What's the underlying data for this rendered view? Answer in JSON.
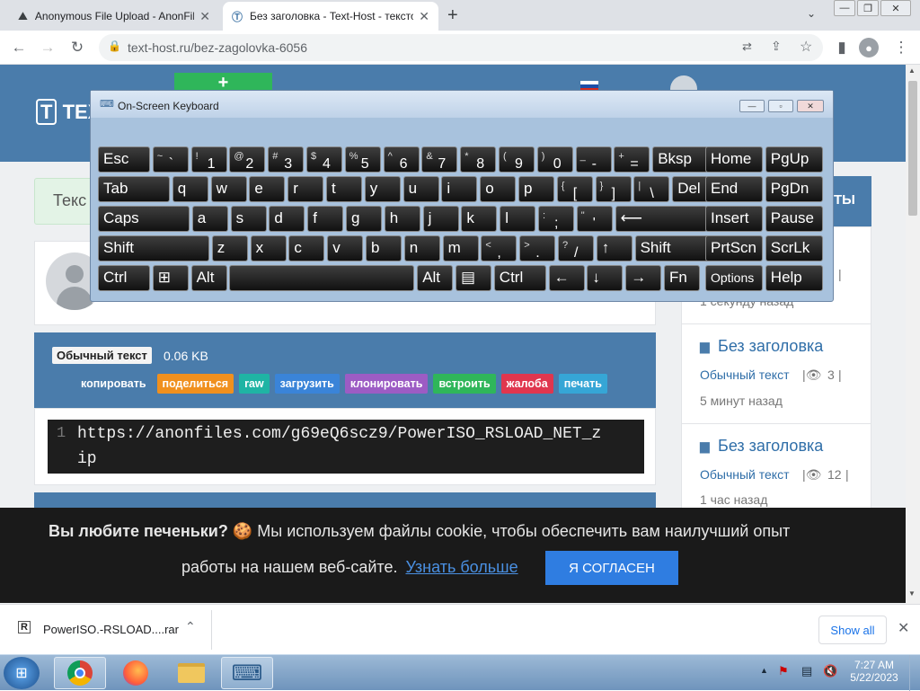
{
  "browser": {
    "tabs": [
      {
        "title": "Anonymous File Upload - AnonFiles",
        "close": "✕"
      },
      {
        "title": "Без заголовка - Text-Host - текстовый",
        "close": "✕"
      }
    ],
    "new_tab": "+",
    "url": "text-host.ru/bez-zagolovka-6056"
  },
  "site": {
    "logo_text": "TEXT",
    "notice": "Текс",
    "paste": {
      "type_badge": "Обычный текст",
      "size": "0.06 KB",
      "actions": [
        "копировать",
        "поделиться",
        "raw",
        "загрузить",
        "клонировать",
        "встроить",
        "жалоба",
        "печать"
      ],
      "action_colors": [
        "#4a7cab",
        "#f0901e",
        "#1fb4a4",
        "#3a84d8",
        "#9c5cc4",
        "#2fb65a",
        "#e0364e",
        "#36a6d6"
      ],
      "line_number": "1",
      "code_line1": "https://anonfiles.com/g69eQ6scz9/PowerISO_RSLOAD_NET_z",
      "code_line2": "ip"
    },
    "sidebar": {
      "header": "ТЫ",
      "item0_meta_end": "|",
      "item0_time": "1 секунду назад",
      "items": [
        {
          "title": "Без заголовка",
          "type": "Обычный текст",
          "views": "3",
          "sep": "|",
          "time": "5 минут назад"
        },
        {
          "title": "Без заголовка",
          "type": "Обычный текст",
          "views": "12",
          "sep": "|",
          "time": "1 час назад"
        }
      ]
    }
  },
  "osk": {
    "title": "On-Screen Keyboard",
    "rows": [
      [
        [
          "Esc"
        ],
        [
          "~",
          "`"
        ],
        [
          "!",
          "1"
        ],
        [
          "@",
          "2"
        ],
        [
          "#",
          "3"
        ],
        [
          "$",
          "4"
        ],
        [
          "%",
          "5"
        ],
        [
          "^",
          "6"
        ],
        [
          "&",
          "7"
        ],
        [
          "*",
          "8"
        ],
        [
          "(",
          "9"
        ],
        [
          ")",
          "0"
        ],
        [
          "_",
          "-"
        ],
        [
          "+",
          "="
        ],
        [
          "Bksp"
        ],
        [
          "Home"
        ],
        [
          "PgUp"
        ]
      ],
      [
        [
          "Tab"
        ],
        [
          "q"
        ],
        [
          "w"
        ],
        [
          "e"
        ],
        [
          "r"
        ],
        [
          "t"
        ],
        [
          "y"
        ],
        [
          "u"
        ],
        [
          "i"
        ],
        [
          "o"
        ],
        [
          "p"
        ],
        [
          "{",
          "["
        ],
        [
          "}",
          "]"
        ],
        [
          "|",
          "\\"
        ],
        [
          "Del"
        ],
        [
          "End"
        ],
        [
          "PgDn"
        ]
      ],
      [
        [
          "Caps"
        ],
        [
          "a"
        ],
        [
          "s"
        ],
        [
          "d"
        ],
        [
          "f"
        ],
        [
          "g"
        ],
        [
          "h"
        ],
        [
          "j"
        ],
        [
          "k"
        ],
        [
          "l"
        ],
        [
          ":",
          ";"
        ],
        [
          "\"",
          "'"
        ],
        [
          "⟵"
        ],
        [
          "Insert"
        ],
        [
          "Pause"
        ]
      ],
      [
        [
          "Shift"
        ],
        [
          "z"
        ],
        [
          "x"
        ],
        [
          "c"
        ],
        [
          "v"
        ],
        [
          "b"
        ],
        [
          "n"
        ],
        [
          "m"
        ],
        [
          "<",
          ","
        ],
        [
          ">",
          "."
        ],
        [
          "?",
          "/"
        ],
        [
          "↑"
        ],
        [
          "Shift"
        ],
        [
          "PrtScn"
        ],
        [
          "ScrLk"
        ]
      ],
      [
        [
          "Ctrl"
        ],
        [
          "⊞"
        ],
        [
          "Alt"
        ],
        [
          ""
        ],
        [
          "Alt"
        ],
        [
          "▤"
        ],
        [
          "Ctrl"
        ],
        [
          "←"
        ],
        [
          "↓"
        ],
        [
          "→"
        ],
        [
          "Fn"
        ],
        [
          "Options"
        ],
        [
          "Help"
        ]
      ]
    ]
  },
  "cookie": {
    "text_bold": "Вы любите печеньки?",
    "text1": " Мы используем файлы cookie, чтобы обеспечить вам наилучший опыт",
    "text2": "работы на нашем веб-сайте.",
    "link": "Узнать больше",
    "accept": "Я СОГЛАСЕН",
    "icon": "🍪"
  },
  "download": {
    "file": "PowerISO.-RSLOAD....rar",
    "show_all": "Show all",
    "close": "✕"
  },
  "taskbar": {
    "time": "7:27 AM",
    "date": "5/22/2023"
  }
}
